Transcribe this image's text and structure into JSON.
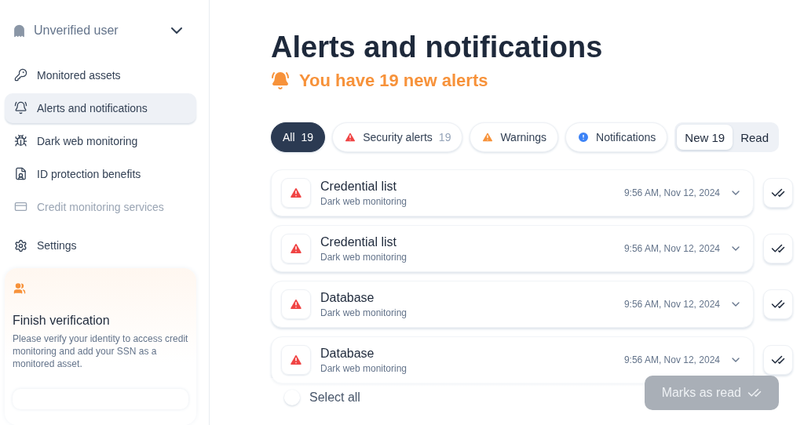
{
  "sidebar": {
    "user": {
      "name": "Unverified user",
      "expanded": false
    },
    "nav": [
      {
        "label": "Monitored assets",
        "kind": "key",
        "selected": false,
        "disabled": false
      },
      {
        "label": "Alerts and notifications",
        "kind": "bell",
        "selected": true,
        "disabled": false
      },
      {
        "label": "Dark web monitoring",
        "kind": "bug",
        "selected": false,
        "disabled": false
      },
      {
        "label": "ID protection benefits",
        "kind": "file",
        "selected": false,
        "disabled": false
      },
      {
        "label": "Credit monitoring services",
        "kind": "card",
        "selected": false,
        "disabled": true
      }
    ],
    "settings": {
      "label": "Settings"
    },
    "verification_card": {
      "title": "Finish verification",
      "text": "Please verify your identity to access credit monitoring and add your SSN as a monitored asset."
    }
  },
  "page": {
    "title": "Alerts and notifications",
    "subtitle": "You have 19 new alerts"
  },
  "filters": [
    {
      "label": "All",
      "count": "19",
      "kind": "all",
      "selected": true
    },
    {
      "label": "Security alerts",
      "count": "19",
      "kind": "danger",
      "selected": false
    },
    {
      "label": "Warnings",
      "kind": "warning",
      "selected": false
    },
    {
      "label": "Notifications",
      "kind": "info",
      "selected": false
    }
  ],
  "read_toggle": [
    {
      "label": "New 19",
      "selected": true
    },
    {
      "label": "Read",
      "selected": false
    }
  ],
  "alerts": [
    {
      "title": "Credential list",
      "source": "Dark web monitoring",
      "time": "9:56 AM, Nov 12, 2024",
      "kind": "danger"
    },
    {
      "title": "Credential list",
      "source": "Dark web monitoring",
      "time": "9:56 AM, Nov 12, 2024",
      "kind": "danger"
    },
    {
      "title": "Database",
      "source": "Dark web monitoring",
      "time": "9:56 AM, Nov 12, 2024",
      "kind": "danger"
    },
    {
      "title": "Database",
      "source": "Dark web monitoring",
      "time": "9:56 AM, Nov 12, 2024",
      "kind": "danger"
    }
  ],
  "footer": {
    "select_all": {
      "label": "Select all",
      "checked": false
    },
    "mark_button": {
      "label": "Marks as read",
      "disabled": true
    }
  }
}
